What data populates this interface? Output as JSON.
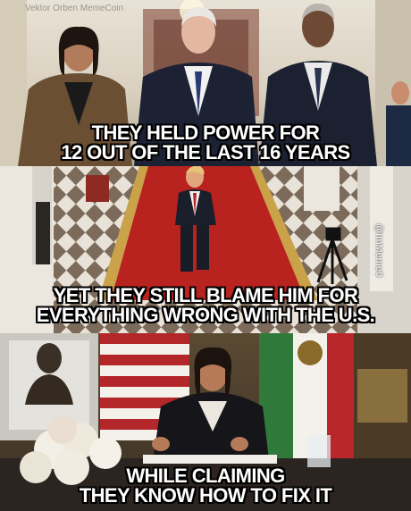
{
  "watermark_top": "Vektor Orben MemeCoin",
  "watermark_side": "@ImMeme0",
  "panel1": {
    "caption": [
      "THEY HELD POWER FOR",
      "12 OUT OF THE LAST 16 YEARS"
    ]
  },
  "panel2": {
    "caption": [
      "YET THEY STILL BLAME HIM FOR",
      "EVERYTHING WRONG WITH THE U.S."
    ]
  },
  "panel3": {
    "caption": [
      "WHILE CLAIMING",
      "THEY KNOW HOW TO FIX IT"
    ]
  }
}
